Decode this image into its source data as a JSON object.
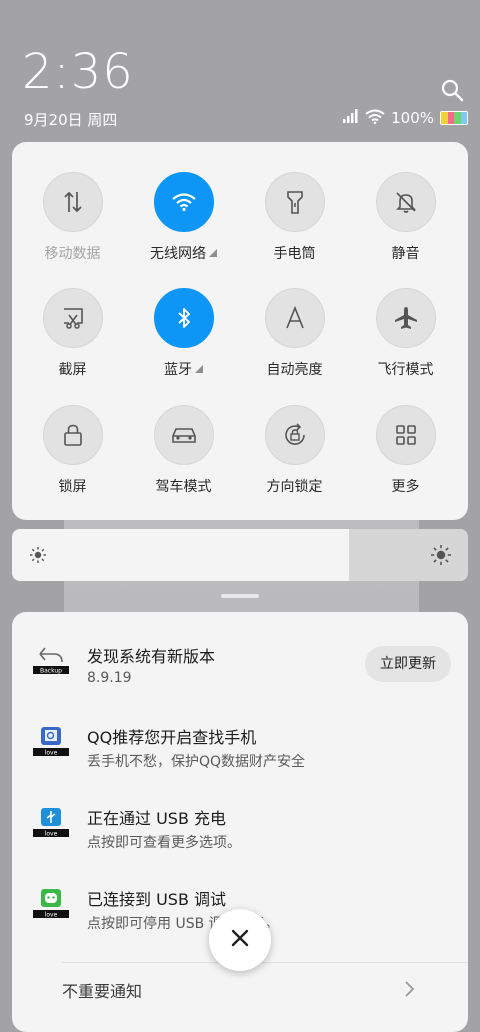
{
  "status": {
    "time": "2:36",
    "date": "9月20日 周四",
    "battery_text": "100%"
  },
  "quick_settings": {
    "tiles": [
      {
        "label": "移动数据",
        "icon": "mobile-data-icon",
        "active": false,
        "dim": true
      },
      {
        "label": "无线网络",
        "icon": "wifi-icon",
        "active": true,
        "expand": true
      },
      {
        "label": "手电筒",
        "icon": "flashlight-icon",
        "active": false
      },
      {
        "label": "静音",
        "icon": "mute-bell-icon",
        "active": false
      },
      {
        "label": "截屏",
        "icon": "screenshot-icon",
        "active": false
      },
      {
        "label": "蓝牙",
        "icon": "bluetooth-icon",
        "active": true,
        "expand": true
      },
      {
        "label": "自动亮度",
        "icon": "auto-brightness-icon",
        "active": false
      },
      {
        "label": "飞行模式",
        "icon": "airplane-icon",
        "active": false
      },
      {
        "label": "锁屏",
        "icon": "lock-icon",
        "active": false
      },
      {
        "label": "驾车模式",
        "icon": "car-icon",
        "active": false
      },
      {
        "label": "方向锁定",
        "icon": "rotation-lock-icon",
        "active": false
      },
      {
        "label": "更多",
        "icon": "grid-icon",
        "active": false
      }
    ]
  },
  "brightness": {
    "level": 0.74
  },
  "notifications": [
    {
      "app": "Backup",
      "title": "发现系统有新版本",
      "subtitle": "8.9.19",
      "action": "立即更新",
      "icon": "backup-icon"
    },
    {
      "app": "love",
      "title": "QQ推荐您开启查找手机",
      "subtitle": "丢手机不愁，保护QQ数据财产安全",
      "icon": "find-phone-icon"
    },
    {
      "app": "love",
      "title": "正在通过 USB 充电",
      "subtitle": "点按即可查看更多选项。",
      "icon": "usb-icon"
    },
    {
      "app": "love",
      "title": "已连接到 USB 调试",
      "subtitle": "点按即可停用 USB 调试功能。",
      "icon": "android-debug-icon"
    }
  ],
  "footer": {
    "unimportant_label": "不重要通知"
  },
  "colors": {
    "accent": "#0d96f6",
    "panel": "#f4f4f4"
  }
}
